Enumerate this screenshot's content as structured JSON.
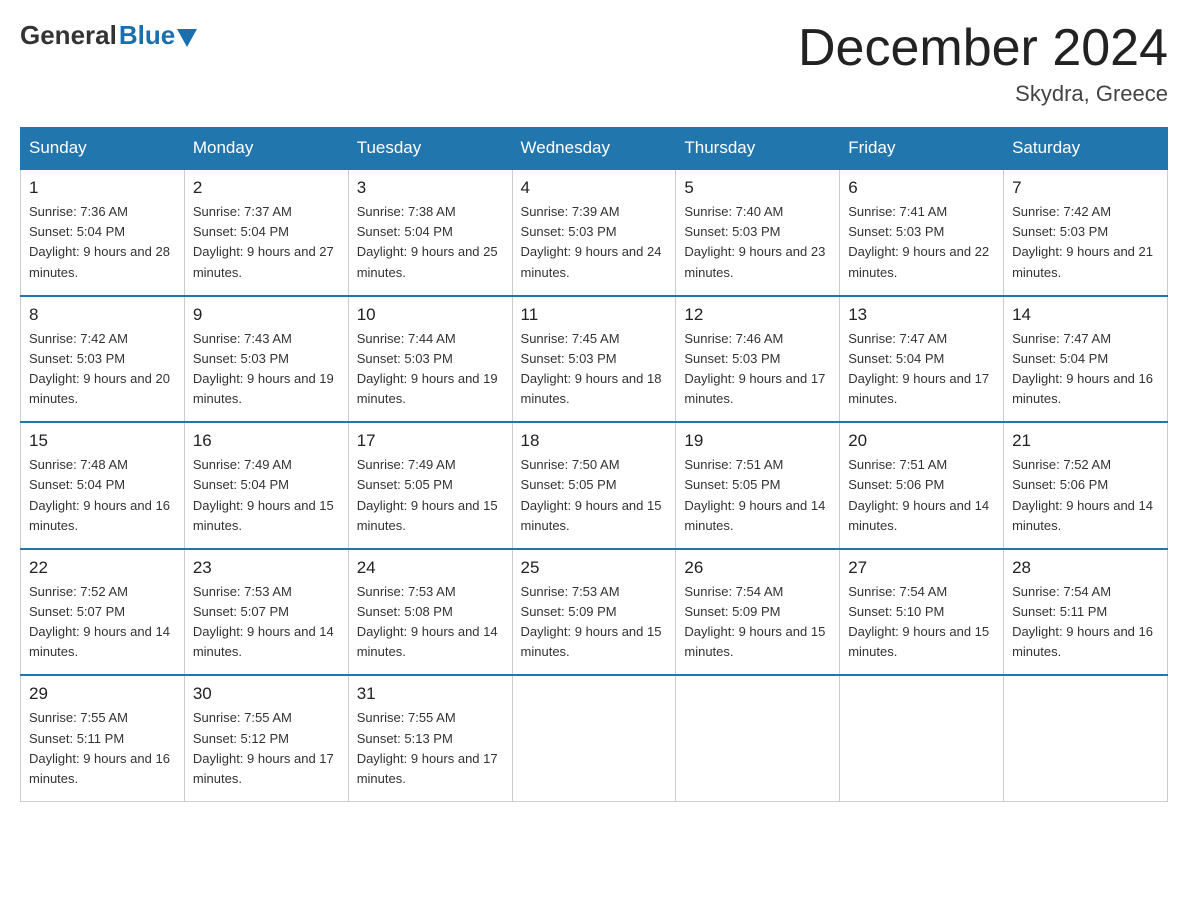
{
  "header": {
    "logo_general": "General",
    "logo_blue": "Blue",
    "month_title": "December 2024",
    "location": "Skydra, Greece"
  },
  "days_of_week": [
    "Sunday",
    "Monday",
    "Tuesday",
    "Wednesday",
    "Thursday",
    "Friday",
    "Saturday"
  ],
  "weeks": [
    [
      {
        "num": "1",
        "sunrise": "7:36 AM",
        "sunset": "5:04 PM",
        "daylight": "9 hours and 28 minutes."
      },
      {
        "num": "2",
        "sunrise": "7:37 AM",
        "sunset": "5:04 PM",
        "daylight": "9 hours and 27 minutes."
      },
      {
        "num": "3",
        "sunrise": "7:38 AM",
        "sunset": "5:04 PM",
        "daylight": "9 hours and 25 minutes."
      },
      {
        "num": "4",
        "sunrise": "7:39 AM",
        "sunset": "5:03 PM",
        "daylight": "9 hours and 24 minutes."
      },
      {
        "num": "5",
        "sunrise": "7:40 AM",
        "sunset": "5:03 PM",
        "daylight": "9 hours and 23 minutes."
      },
      {
        "num": "6",
        "sunrise": "7:41 AM",
        "sunset": "5:03 PM",
        "daylight": "9 hours and 22 minutes."
      },
      {
        "num": "7",
        "sunrise": "7:42 AM",
        "sunset": "5:03 PM",
        "daylight": "9 hours and 21 minutes."
      }
    ],
    [
      {
        "num": "8",
        "sunrise": "7:42 AM",
        "sunset": "5:03 PM",
        "daylight": "9 hours and 20 minutes."
      },
      {
        "num": "9",
        "sunrise": "7:43 AM",
        "sunset": "5:03 PM",
        "daylight": "9 hours and 19 minutes."
      },
      {
        "num": "10",
        "sunrise": "7:44 AM",
        "sunset": "5:03 PM",
        "daylight": "9 hours and 19 minutes."
      },
      {
        "num": "11",
        "sunrise": "7:45 AM",
        "sunset": "5:03 PM",
        "daylight": "9 hours and 18 minutes."
      },
      {
        "num": "12",
        "sunrise": "7:46 AM",
        "sunset": "5:03 PM",
        "daylight": "9 hours and 17 minutes."
      },
      {
        "num": "13",
        "sunrise": "7:47 AM",
        "sunset": "5:04 PM",
        "daylight": "9 hours and 17 minutes."
      },
      {
        "num": "14",
        "sunrise": "7:47 AM",
        "sunset": "5:04 PM",
        "daylight": "9 hours and 16 minutes."
      }
    ],
    [
      {
        "num": "15",
        "sunrise": "7:48 AM",
        "sunset": "5:04 PM",
        "daylight": "9 hours and 16 minutes."
      },
      {
        "num": "16",
        "sunrise": "7:49 AM",
        "sunset": "5:04 PM",
        "daylight": "9 hours and 15 minutes."
      },
      {
        "num": "17",
        "sunrise": "7:49 AM",
        "sunset": "5:05 PM",
        "daylight": "9 hours and 15 minutes."
      },
      {
        "num": "18",
        "sunrise": "7:50 AM",
        "sunset": "5:05 PM",
        "daylight": "9 hours and 15 minutes."
      },
      {
        "num": "19",
        "sunrise": "7:51 AM",
        "sunset": "5:05 PM",
        "daylight": "9 hours and 14 minutes."
      },
      {
        "num": "20",
        "sunrise": "7:51 AM",
        "sunset": "5:06 PM",
        "daylight": "9 hours and 14 minutes."
      },
      {
        "num": "21",
        "sunrise": "7:52 AM",
        "sunset": "5:06 PM",
        "daylight": "9 hours and 14 minutes."
      }
    ],
    [
      {
        "num": "22",
        "sunrise": "7:52 AM",
        "sunset": "5:07 PM",
        "daylight": "9 hours and 14 minutes."
      },
      {
        "num": "23",
        "sunrise": "7:53 AM",
        "sunset": "5:07 PM",
        "daylight": "9 hours and 14 minutes."
      },
      {
        "num": "24",
        "sunrise": "7:53 AM",
        "sunset": "5:08 PM",
        "daylight": "9 hours and 14 minutes."
      },
      {
        "num": "25",
        "sunrise": "7:53 AM",
        "sunset": "5:09 PM",
        "daylight": "9 hours and 15 minutes."
      },
      {
        "num": "26",
        "sunrise": "7:54 AM",
        "sunset": "5:09 PM",
        "daylight": "9 hours and 15 minutes."
      },
      {
        "num": "27",
        "sunrise": "7:54 AM",
        "sunset": "5:10 PM",
        "daylight": "9 hours and 15 minutes."
      },
      {
        "num": "28",
        "sunrise": "7:54 AM",
        "sunset": "5:11 PM",
        "daylight": "9 hours and 16 minutes."
      }
    ],
    [
      {
        "num": "29",
        "sunrise": "7:55 AM",
        "sunset": "5:11 PM",
        "daylight": "9 hours and 16 minutes."
      },
      {
        "num": "30",
        "sunrise": "7:55 AM",
        "sunset": "5:12 PM",
        "daylight": "9 hours and 17 minutes."
      },
      {
        "num": "31",
        "sunrise": "7:55 AM",
        "sunset": "5:13 PM",
        "daylight": "9 hours and 17 minutes."
      },
      null,
      null,
      null,
      null
    ]
  ]
}
